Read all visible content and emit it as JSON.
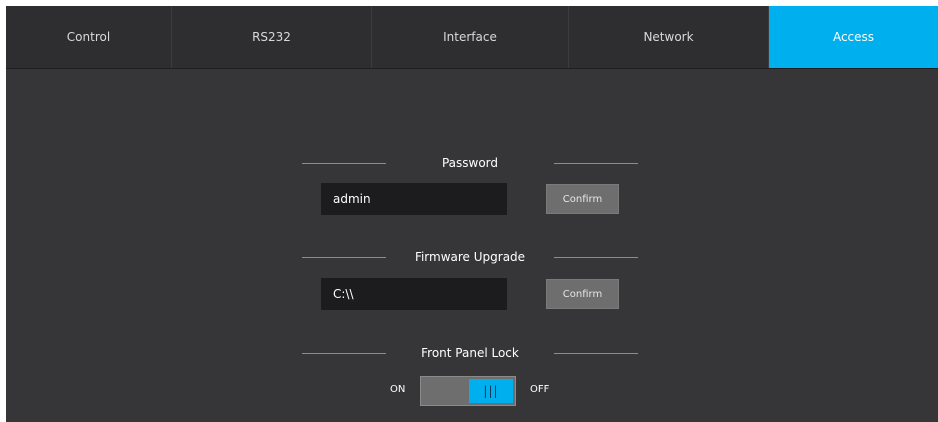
{
  "tabs": [
    {
      "label": "Control",
      "active": false
    },
    {
      "label": "RS232",
      "active": false
    },
    {
      "label": "Interface",
      "active": false
    },
    {
      "label": "Network",
      "active": false
    },
    {
      "label": "Access",
      "active": true
    }
  ],
  "password": {
    "title": "Password",
    "value": "admin",
    "confirm_label": "Confirm"
  },
  "firmware": {
    "title": "Firmware Upgrade",
    "value": "C:\\\\",
    "confirm_label": "Confirm"
  },
  "front_panel_lock": {
    "title": "Front Panel Lock",
    "on_label": "ON",
    "off_label": "OFF",
    "knob_glyph": "|||",
    "state": "OFF"
  },
  "colors": {
    "accent": "#00b0ee",
    "background": "#363538",
    "tabbar": "#2e2e30",
    "field": "#1c1c1e",
    "button": "#6e6e6e"
  }
}
